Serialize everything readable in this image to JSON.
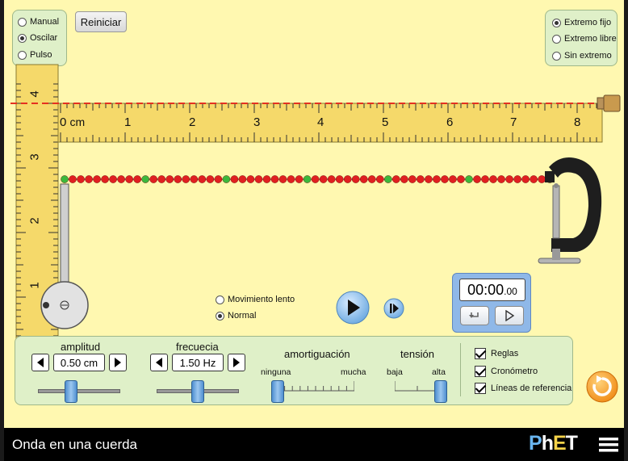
{
  "mode": {
    "options": [
      {
        "label": "Manual",
        "selected": false
      },
      {
        "label": "Oscilar",
        "selected": true
      },
      {
        "label": "Pulso",
        "selected": false
      }
    ]
  },
  "reset_label": "Reiniciar",
  "end": {
    "options": [
      {
        "label": "Extremo fijo",
        "selected": true
      },
      {
        "label": "Extremo libre",
        "selected": false
      },
      {
        "label": "Sin extremo",
        "selected": false
      }
    ]
  },
  "horizontal_ruler": {
    "unit": "cm",
    "ticks": [
      "0",
      "1",
      "2",
      "3",
      "4",
      "5",
      "6",
      "7",
      "8"
    ]
  },
  "vertical_ruler": {
    "ticks": [
      "4",
      "3",
      "2",
      "1"
    ]
  },
  "speed": {
    "options": [
      {
        "label": "Movimiento lento",
        "selected": false
      },
      {
        "label": "Normal",
        "selected": true
      }
    ]
  },
  "timer": {
    "main": "00:00",
    "fraction": ".00"
  },
  "controls": {
    "amplitude": {
      "label": "amplitud",
      "value": "0.50 cm",
      "level": 0.4
    },
    "frequency": {
      "label": "frecuecia",
      "value": "1.50 Hz",
      "level": 0.5
    },
    "damping": {
      "label": "amortiguación",
      "min_label": "ninguna",
      "max_label": "mucha",
      "level": 0.0
    },
    "tension": {
      "label": "tensión",
      "min_label": "baja",
      "max_label": "alta",
      "level": 1.0
    }
  },
  "checks": [
    {
      "label": "Reglas",
      "checked": true
    },
    {
      "label": "Cronómetro",
      "checked": true
    },
    {
      "label": "Líneas de referencia",
      "checked": true
    }
  ],
  "footer": {
    "title": "Onda en una cuerda",
    "brand": "PhET"
  },
  "colors": {
    "bead_red": "#e02020",
    "bead_green": "#3cb83c",
    "ruler": "#F5D96A",
    "ref_line": "#e53020"
  }
}
